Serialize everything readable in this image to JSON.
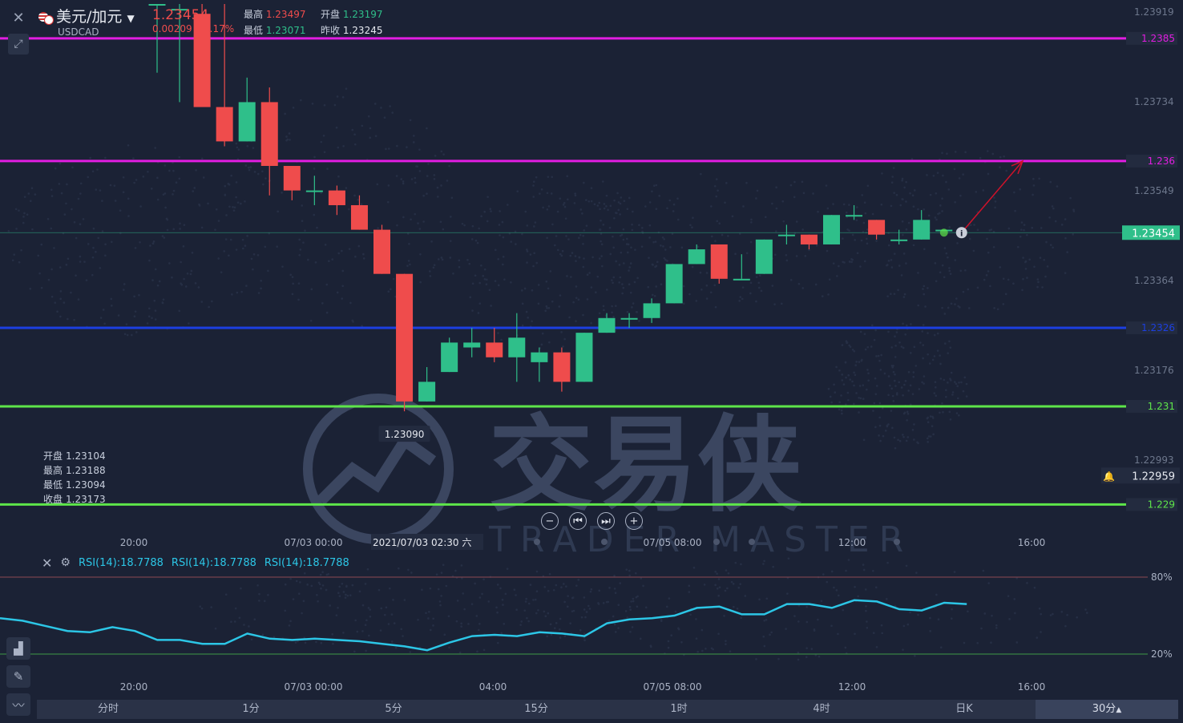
{
  "header": {
    "close_icon": "close-icon",
    "expand_icon": "expand-icon",
    "symbol_name": "美元/加元",
    "symbol_code": "USDCAD",
    "price": "1.23454",
    "change": "0.00209",
    "change_pct": "0.17%",
    "stats": {
      "high_label": "最高",
      "high": "1.23497",
      "open_label": "开盘",
      "open": "1.23197",
      "low_label": "最低",
      "low": "1.23071",
      "prev_close_label": "昨收",
      "prev_close": "1.23245"
    }
  },
  "colors": {
    "up": "#2fbf8a",
    "down": "#ef4c4c",
    "magenta": "#e11de1",
    "blue": "#1c3fe0",
    "green": "#5ee64a",
    "rsi": "#2cc6e6",
    "bg": "#1b2235"
  },
  "price_axis_labels": [
    "1.23919",
    "1.23734",
    "1.23549",
    "1.23364",
    "1.23176",
    "1.22993"
  ],
  "hlines": [
    {
      "value": 1.2385,
      "label": "1.2385",
      "color": "#e11de1"
    },
    {
      "value": 1.236,
      "label": "1.236",
      "color": "#e11de1"
    },
    {
      "value": 1.2326,
      "label": "1.2326",
      "color": "#1c3fe0"
    },
    {
      "value": 1.231,
      "label": "1.231",
      "color": "#5ee64a"
    },
    {
      "value": 1.229,
      "label": "1.229",
      "color": "#5ee64a"
    }
  ],
  "current_price_tag": "1.23454",
  "alert_price": "1.22959",
  "low_marker": "1.23090",
  "crosshair_time": "2021/07/03 02:30 六",
  "time_axis": [
    "20:00",
    "07/03 00:00",
    "04:00",
    "07/05 08:00",
    "12:00",
    "16:00"
  ],
  "ohlc_box": {
    "open_label": "开盘",
    "open": "1.23104",
    "high_label": "最高",
    "high": "1.23188",
    "low_label": "最低",
    "low": "1.23094",
    "close_label": "收盘",
    "close": "1.23173"
  },
  "watermark": {
    "cn": "交易侠",
    "en": "TRADER MASTER"
  },
  "rsi": {
    "labels": [
      "RSI(14):18.7788",
      "RSI(14):18.7788",
      "RSI(14):18.7788"
    ],
    "level_high": "80%",
    "level_low": "20%"
  },
  "timeframes": [
    "分时",
    "1分",
    "5分",
    "15分",
    "1时",
    "4时",
    "日K",
    "30分"
  ],
  "chart_data": {
    "type": "candlestick",
    "y_range": [
      1.2285,
      1.2392
    ],
    "candles": [
      {
        "o": 1.2392,
        "c": 1.2392,
        "h": 1.2392,
        "l": 1.2378
      },
      {
        "o": 1.2391,
        "c": 1.2391,
        "h": 1.2392,
        "l": 1.2372
      },
      {
        "o": 1.239,
        "c": 1.2371,
        "h": 1.2392,
        "l": 1.2371
      },
      {
        "o": 1.2371,
        "c": 1.2364,
        "h": 1.2392,
        "l": 1.2363
      },
      {
        "o": 1.2364,
        "c": 1.2372,
        "h": 1.2377,
        "l": 1.2364
      },
      {
        "o": 1.2372,
        "c": 1.2359,
        "h": 1.2375,
        "l": 1.2353
      },
      {
        "o": 1.2359,
        "c": 1.2354,
        "h": 1.2359,
        "l": 1.2352
      },
      {
        "o": 1.2354,
        "c": 1.2354,
        "h": 1.2357,
        "l": 1.2351
      },
      {
        "o": 1.2354,
        "c": 1.2351,
        "h": 1.2355,
        "l": 1.2349
      },
      {
        "o": 1.2351,
        "c": 1.2346,
        "h": 1.2353,
        "l": 1.2346
      },
      {
        "o": 1.2346,
        "c": 1.2337,
        "h": 1.2347,
        "l": 1.2337
      },
      {
        "o": 1.2337,
        "c": 1.2311,
        "h": 1.2337,
        "l": 1.2309
      },
      {
        "o": 1.2311,
        "c": 1.2315,
        "h": 1.2318,
        "l": 1.2311
      },
      {
        "o": 1.2317,
        "c": 1.2323,
        "h": 1.2324,
        "l": 1.2317
      },
      {
        "o": 1.2322,
        "c": 1.2323,
        "h": 1.2326,
        "l": 1.232
      },
      {
        "o": 1.2323,
        "c": 1.232,
        "h": 1.2326,
        "l": 1.2319
      },
      {
        "o": 1.232,
        "c": 1.2324,
        "h": 1.2329,
        "l": 1.2315
      },
      {
        "o": 1.2319,
        "c": 1.2321,
        "h": 1.2322,
        "l": 1.2315
      },
      {
        "o": 1.2321,
        "c": 1.2315,
        "h": 1.2322,
        "l": 1.2313
      },
      {
        "o": 1.2315,
        "c": 1.2325,
        "h": 1.2325,
        "l": 1.2315
      },
      {
        "o": 1.2325,
        "c": 1.2328,
        "h": 1.2329,
        "l": 1.2325
      },
      {
        "o": 1.2328,
        "c": 1.2328,
        "h": 1.2329,
        "l": 1.2326
      },
      {
        "o": 1.2328,
        "c": 1.2331,
        "h": 1.2332,
        "l": 1.2327
      },
      {
        "o": 1.2331,
        "c": 1.2339,
        "h": 1.2339,
        "l": 1.2331
      },
      {
        "o": 1.2339,
        "c": 1.2342,
        "h": 1.2343,
        "l": 1.2339
      },
      {
        "o": 1.2343,
        "c": 1.2336,
        "h": 1.2343,
        "l": 1.2335
      },
      {
        "o": 1.2336,
        "c": 1.2336,
        "h": 1.2341,
        "l": 1.2336
      },
      {
        "o": 1.2337,
        "c": 1.2344,
        "h": 1.2344,
        "l": 1.2337
      },
      {
        "o": 1.2345,
        "c": 1.2345,
        "h": 1.2347,
        "l": 1.2343
      },
      {
        "o": 1.2345,
        "c": 1.2343,
        "h": 1.2345,
        "l": 1.2342
      },
      {
        "o": 1.2343,
        "c": 1.2349,
        "h": 1.2349,
        "l": 1.2343
      },
      {
        "o": 1.2349,
        "c": 1.2349,
        "h": 1.2351,
        "l": 1.2348
      },
      {
        "o": 1.2348,
        "c": 1.2345,
        "h": 1.2348,
        "l": 1.2344
      },
      {
        "o": 1.2344,
        "c": 1.2344,
        "h": 1.2346,
        "l": 1.2343
      },
      {
        "o": 1.2344,
        "c": 1.2348,
        "h": 1.235,
        "l": 1.2344
      },
      {
        "o": 1.2346,
        "c": 1.2346,
        "h": 1.2346,
        "l": 1.2346
      }
    ],
    "rsi_values": [
      48,
      46,
      42,
      38,
      37,
      41,
      38,
      31,
      31,
      28,
      28,
      36,
      32,
      31,
      32,
      31,
      30,
      28,
      26,
      23,
      29,
      34,
      35,
      34,
      37,
      36,
      34,
      44,
      47,
      48,
      50,
      56,
      57,
      51,
      51,
      59,
      59,
      56,
      62,
      61,
      55,
      54,
      60,
      59
    ]
  }
}
